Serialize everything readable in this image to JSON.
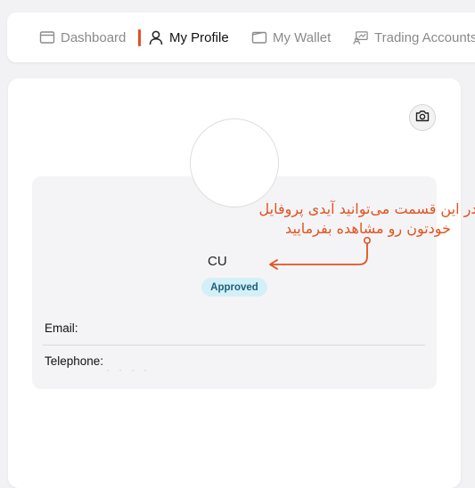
{
  "nav": {
    "items": [
      {
        "label": "Dashboard",
        "icon": "dashboard-icon",
        "active": false
      },
      {
        "label": "My Profile",
        "icon": "user-icon",
        "active": true
      },
      {
        "label": "My Wallet",
        "icon": "wallet-icon",
        "active": false
      },
      {
        "label": "Trading Accounts",
        "icon": "trading-accounts-icon",
        "active": false
      }
    ]
  },
  "profile": {
    "user_id": "CU",
    "status": "Approved",
    "fields": {
      "email_label": "Email:",
      "telephone_label": "Telephone:"
    }
  },
  "annotation": {
    "line1": "در این قسمت می‌توانید آیدی پروفایل",
    "line2": "خودتون رو مشاهده بفرمایید"
  },
  "colors": {
    "accent": "#e2531f",
    "badge_bg": "#d3f0f8",
    "badge_text": "#1f5f77"
  }
}
